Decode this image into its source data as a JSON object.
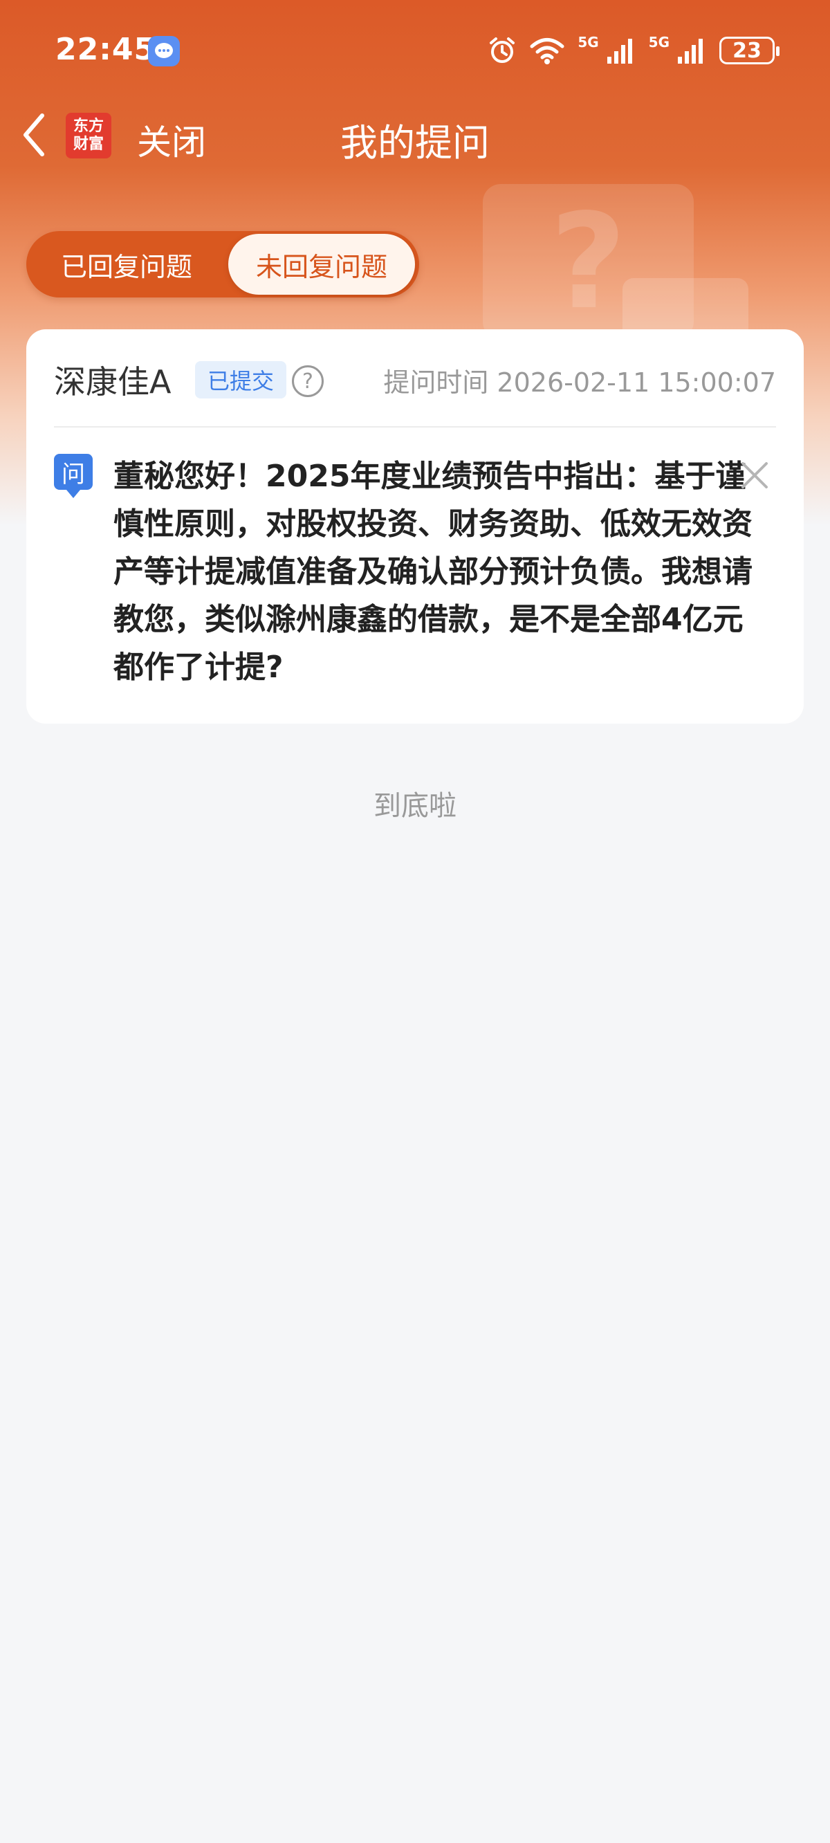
{
  "status_bar": {
    "time": "22:45",
    "battery": "23",
    "network_1": "5G",
    "network_2": "5G",
    "icons": [
      "message-icon",
      "alarm-icon",
      "wifi-icon",
      "signal-icon",
      "signal-icon",
      "battery-icon"
    ]
  },
  "nav": {
    "logo_line1": "东方",
    "logo_line2": "财富",
    "close_label": "关闭",
    "title": "我的提问"
  },
  "tabs": [
    {
      "label": "已回复问题",
      "selected": false
    },
    {
      "label": "未回复问题",
      "selected": true
    }
  ],
  "question_card": {
    "stock_name": "深康佳A",
    "status": "已提交",
    "ask_time": "提问时间 2026-02-11 15:00:07",
    "tag": "问",
    "question": "董秘您好！2025年度业绩预告中指出：基于谨慎性原则，对股权投资、财务资助、低效无效资产等计提减值准备及确认部分预计负债。我想请教您，类似滁州康鑫的借款，是不是全部4亿元都作了计提?"
  },
  "footer": {
    "end_text": "到底啦"
  },
  "colors": {
    "brand_orange": "#dc5a28",
    "accent_blue": "#3e7ee6",
    "background": "#f5f6f8"
  }
}
